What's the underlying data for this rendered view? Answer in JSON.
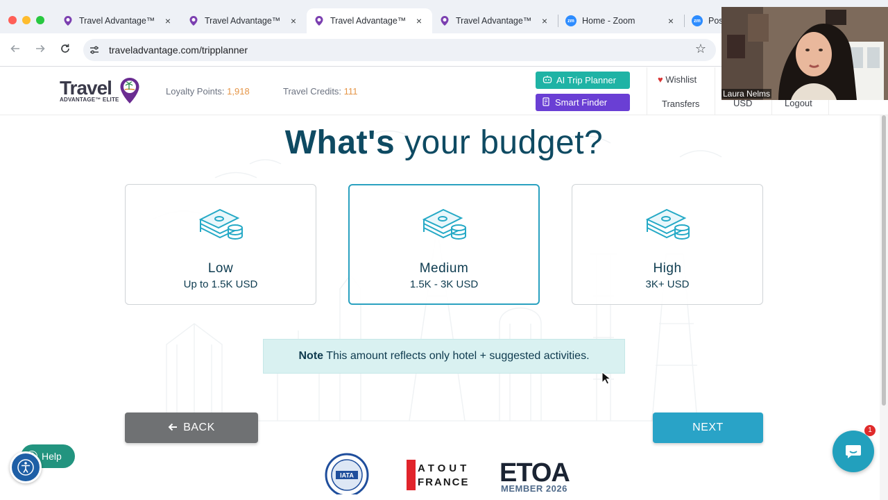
{
  "browser": {
    "tabs": [
      {
        "title": "Travel Advantage™",
        "icon": "travel-advantage-pin-icon",
        "active": false
      },
      {
        "title": "Travel Advantage™",
        "icon": "travel-advantage-pin-icon",
        "active": false
      },
      {
        "title": "Travel Advantage™",
        "icon": "travel-advantage-pin-icon",
        "active": true
      },
      {
        "title": "Travel Advantage™",
        "icon": "travel-advantage-pin-icon",
        "active": false
      },
      {
        "title": "Home - Zoom",
        "icon": "zoom-icon",
        "active": false
      },
      {
        "title": "Post",
        "icon": "zoom-icon",
        "active": false
      }
    ],
    "close_glyph": "×",
    "url": "traveladvantage.com/tripplanner",
    "zoom_icon_text": "zm"
  },
  "header": {
    "logo_word": "Travel",
    "logo_sub": "ADVANTAGE™ ELITE",
    "loyalty_label": "Loyalty Points:",
    "loyalty_value": "1,918",
    "credits_label": "Travel Credits:",
    "credits_value": "111",
    "ai_trip_planner": "AI Trip Planner",
    "smart_finder": "Smart Finder",
    "wishlist": "Wishlist",
    "transfers": "Transfers",
    "currency": "USD",
    "logout": "Logout"
  },
  "main": {
    "heading_bold": "What's",
    "heading_rest": "your budget?",
    "options": [
      {
        "name": "Low",
        "range": "Up to 1.5K USD",
        "selected": false
      },
      {
        "name": "Medium",
        "range": "1.5K - 3K USD",
        "selected": true
      },
      {
        "name": "High",
        "range": "3K+ USD",
        "selected": false
      }
    ],
    "note_label": "Note",
    "note_text": "This amount reflects only hotel + suggested activities.",
    "back": "BACK",
    "next": "NEXT"
  },
  "widgets": {
    "help": "Help",
    "chat_badge": "1"
  },
  "footer_badges": {
    "iata": "IATA",
    "atout": "ATOUT",
    "france": "FRANCE",
    "etoa": "ETOA",
    "etoa_sub": "MEMBER 2026"
  },
  "webcam": {
    "name": "Laura Nelms"
  },
  "colors": {
    "brand_teal": "#29a3c7",
    "heading": "#0e4a62",
    "ai_button": "#1fb3a5",
    "smart_finder": "#6a3fd4",
    "accent_orange": "#e59547"
  }
}
